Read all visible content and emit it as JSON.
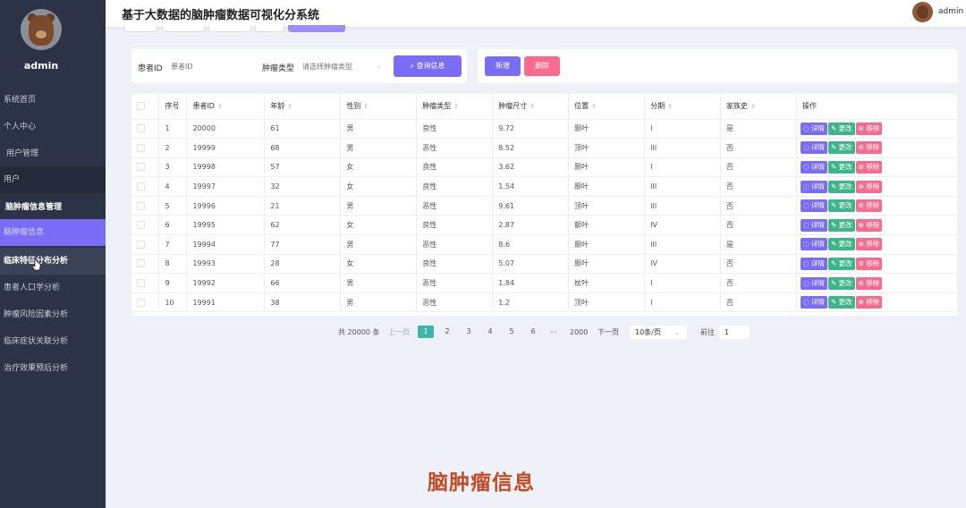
{
  "sidebar": {
    "username": "admin",
    "items": [
      {
        "label": "系统首页",
        "style": "normal"
      },
      {
        "label": "个人中心",
        "style": "normal"
      },
      {
        "label": "用户管理",
        "style": "sub"
      },
      {
        "label": "用户",
        "style": "dark"
      },
      {
        "label": "脑肿瘤信息管理",
        "style": "section"
      },
      {
        "label": "脑肿瘤信息",
        "style": "active"
      },
      {
        "label": "临床特征分布分析",
        "style": "hover"
      },
      {
        "label": "患者人口学分析",
        "style": "normal"
      },
      {
        "label": "肿瘤风险因素分析",
        "style": "normal"
      },
      {
        "label": "临床症状关联分析",
        "style": "normal"
      },
      {
        "label": "治疗效果预后分析",
        "style": "normal"
      }
    ]
  },
  "header": {
    "title": "基于大数据的脑肿瘤数据可视化分系统",
    "user": "admin"
  },
  "search": {
    "patient_id_label": "患者ID",
    "patient_id_placeholder": "患者ID",
    "tumor_type_label": "肿瘤类型",
    "tumor_type_placeholder": "请选择肿瘤类型",
    "query_label": "查询信息"
  },
  "actions": {
    "add_label": "新增",
    "delete_label": "删除"
  },
  "table": {
    "headers": [
      "序号",
      "患者ID",
      "年龄",
      "性别",
      "肿瘤类型",
      "肿瘤尺寸",
      "位置",
      "分期",
      "家族史",
      "操作"
    ],
    "rows": [
      [
        "1",
        "20000",
        "61",
        "男",
        "良性",
        "9.72",
        "颞叶",
        "I",
        "是"
      ],
      [
        "2",
        "19999",
        "68",
        "男",
        "恶性",
        "8.52",
        "顶叶",
        "III",
        "否"
      ],
      [
        "3",
        "19998",
        "57",
        "女",
        "良性",
        "3.62",
        "颞叶",
        "I",
        "否"
      ],
      [
        "4",
        "19997",
        "32",
        "女",
        "良性",
        "1.54",
        "颞叶",
        "III",
        "否"
      ],
      [
        "5",
        "19996",
        "21",
        "男",
        "恶性",
        "9.61",
        "顶叶",
        "III",
        "否"
      ],
      [
        "6",
        "19995",
        "62",
        "女",
        "良性",
        "2.87",
        "额叶",
        "IV",
        "否"
      ],
      [
        "7",
        "19994",
        "77",
        "男",
        "恶性",
        "8.6",
        "颞叶",
        "III",
        "是"
      ],
      [
        "8",
        "19993",
        "28",
        "女",
        "良性",
        "5.07",
        "颞叶",
        "IV",
        "否"
      ],
      [
        "9",
        "19992",
        "66",
        "男",
        "恶性",
        "1.84",
        "枕叶",
        "I",
        "否"
      ],
      [
        "10",
        "19991",
        "38",
        "男",
        "恶性",
        "1.2",
        "顶叶",
        "I",
        "否"
      ]
    ],
    "op_detail": "详情",
    "op_edit": "更改",
    "op_remove": "移除"
  },
  "pagination": {
    "total": "共 20000 条",
    "prev": "上一页",
    "pages": [
      "1",
      "2",
      "3",
      "4",
      "5",
      "6"
    ],
    "ellipsis": "···",
    "last": "2000",
    "next": "下一页",
    "page_size": "10条/页",
    "goto_label": "前往",
    "goto_value": "1"
  },
  "caption": "脑肿瘤信息"
}
